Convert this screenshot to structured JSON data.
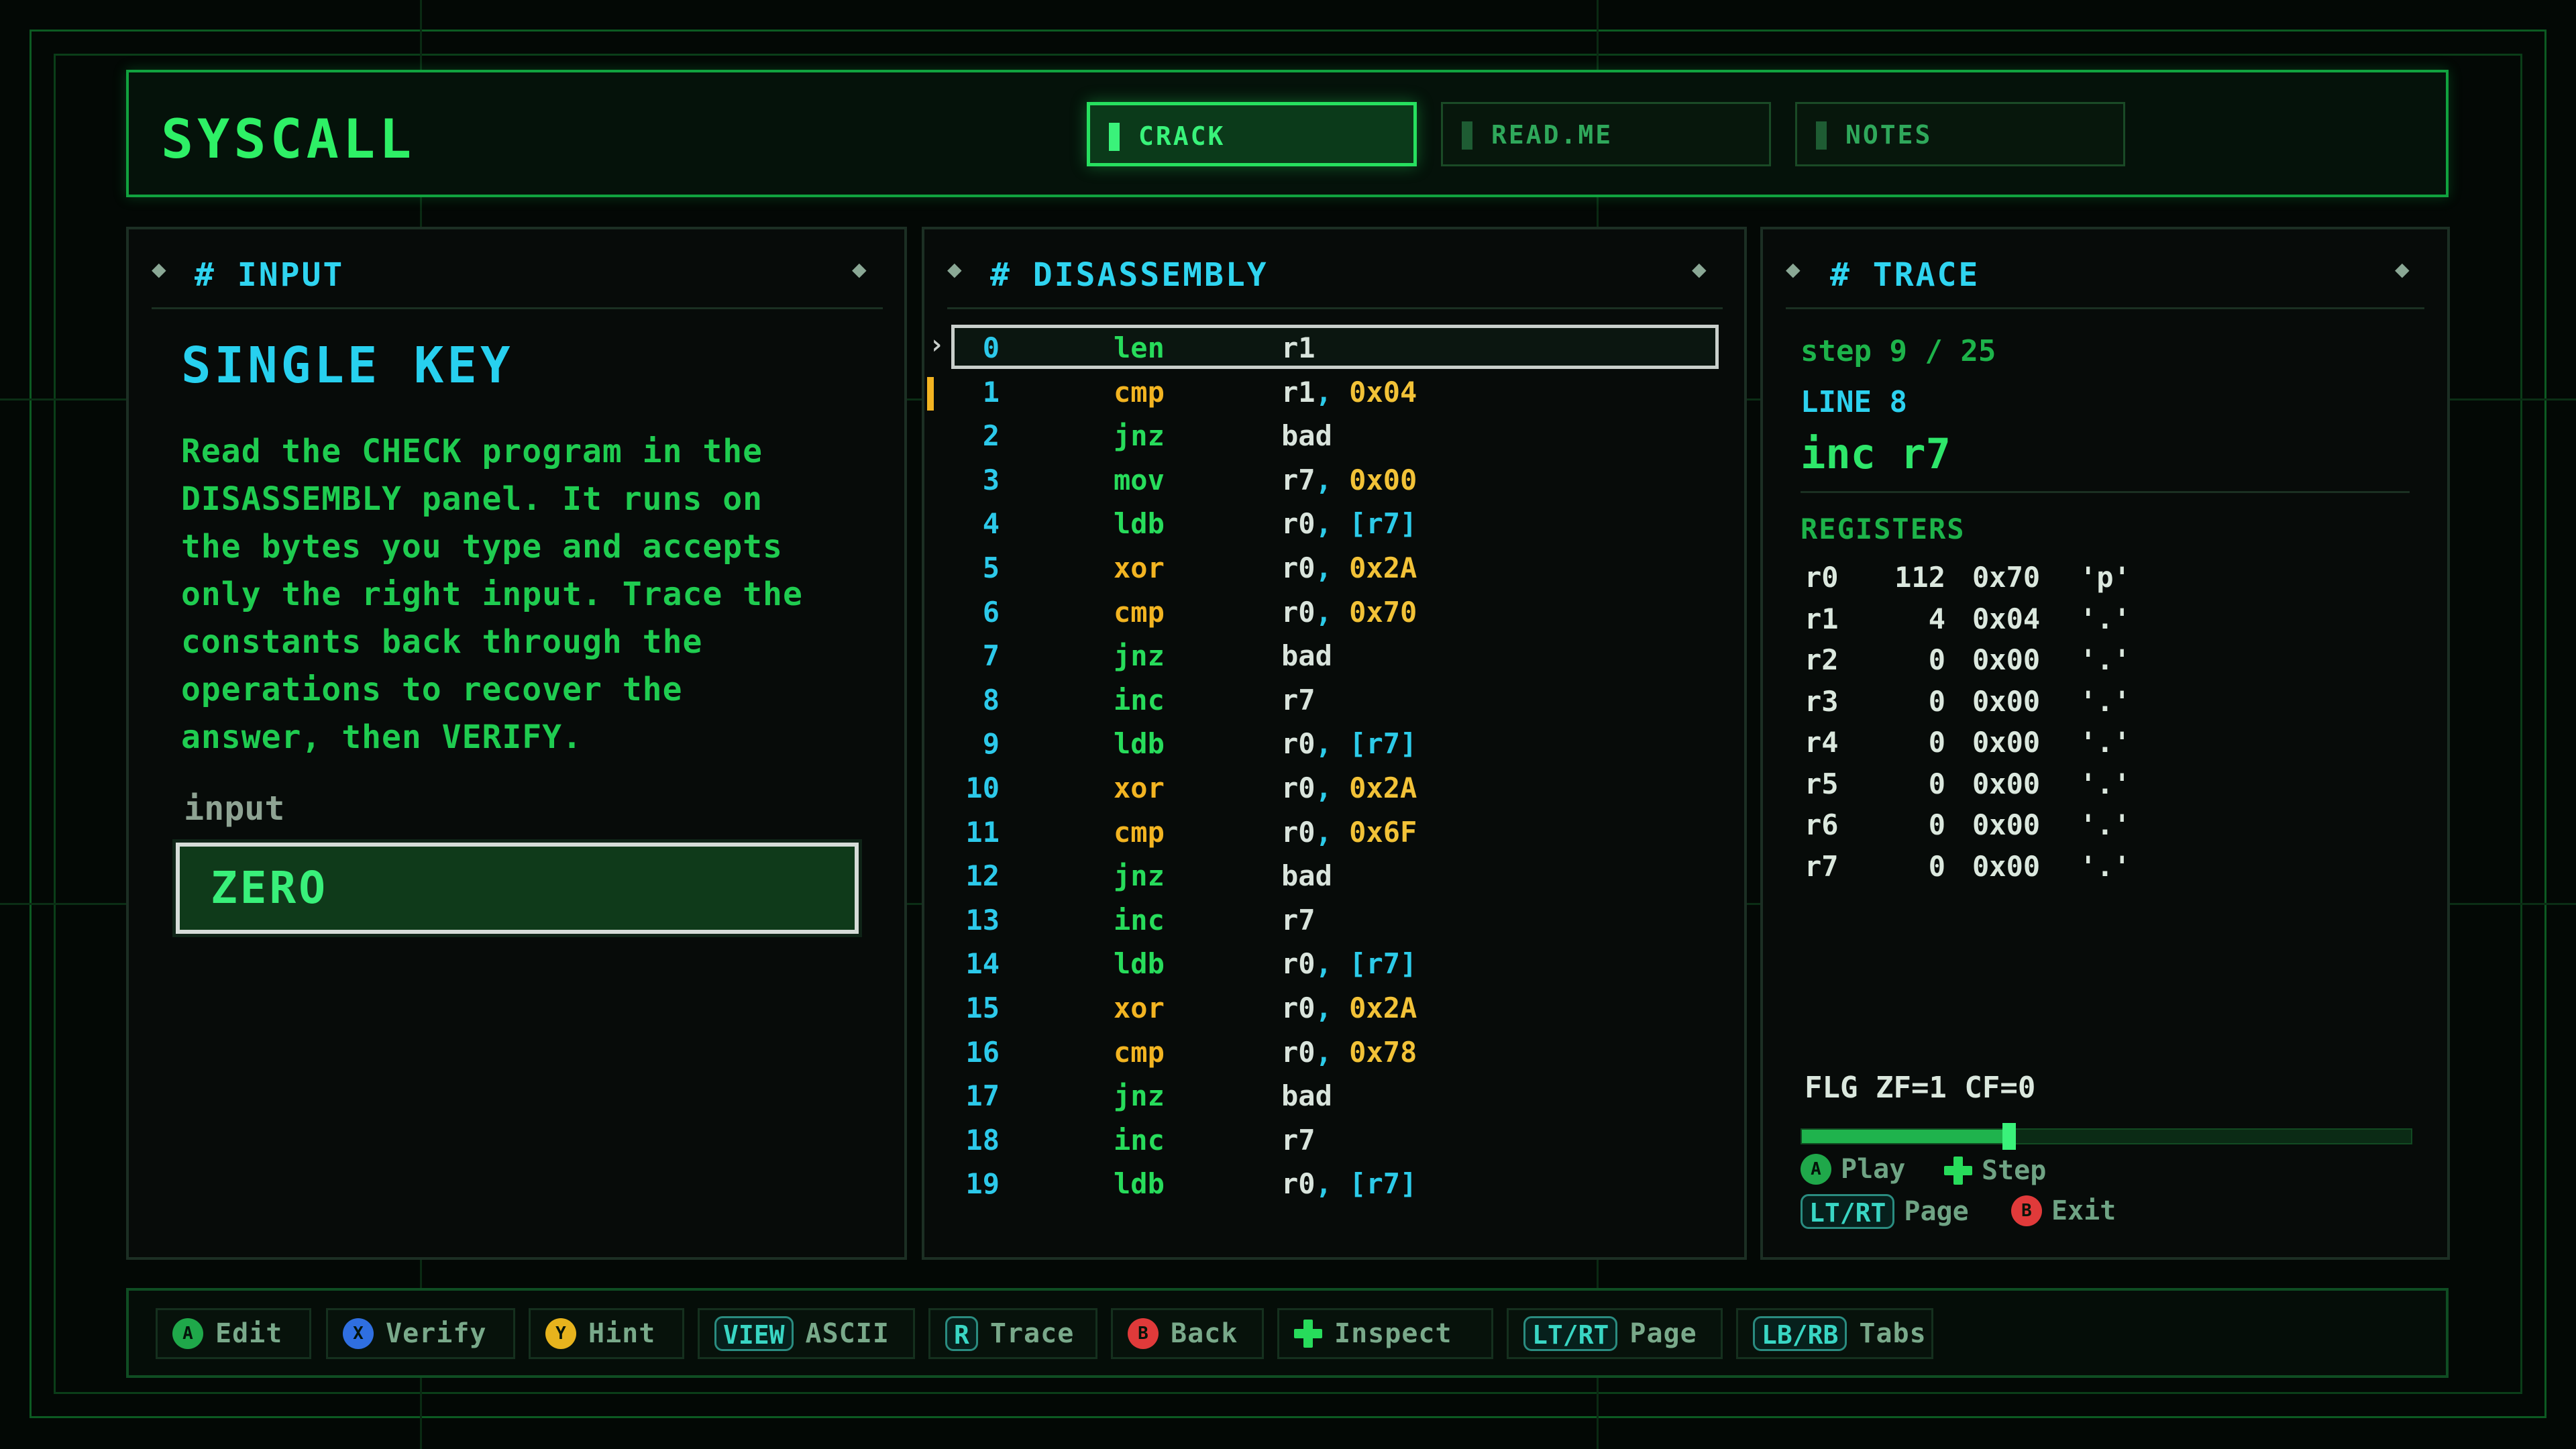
{
  "app": {
    "title": "SYSCALL"
  },
  "tabs": [
    {
      "label": "CRACK",
      "active": true
    },
    {
      "label": "READ.ME",
      "active": false
    },
    {
      "label": "NOTES",
      "active": false
    }
  ],
  "input_panel": {
    "header": "# INPUT",
    "title": "SINGLE KEY",
    "description": [
      "Read the CHECK program in the",
      "DISASSEMBLY panel. It runs on",
      "the bytes you type and accepts",
      "only the right input. Trace the",
      "constants back through the",
      "operations to recover the",
      "answer, then VERIFY."
    ],
    "field_label": "input",
    "field_value": "ZERO"
  },
  "disassembly_panel": {
    "header": "# DISASSEMBLY",
    "selected_index": 0,
    "breakpoint_index": 1,
    "lines": [
      {
        "idx": "0",
        "op": "len",
        "args": [
          {
            "t": "r1",
            "k": "reg"
          }
        ]
      },
      {
        "idx": "1",
        "op": "cmp",
        "args": [
          {
            "t": "r1",
            "k": "reg"
          },
          {
            "t": "0x04",
            "k": "imm"
          }
        ]
      },
      {
        "idx": "2",
        "op": "jnz",
        "args": [
          {
            "t": "bad",
            "k": "reg"
          }
        ]
      },
      {
        "idx": "3",
        "op": "mov",
        "args": [
          {
            "t": "r7",
            "k": "reg"
          },
          {
            "t": "0x00",
            "k": "imm"
          }
        ]
      },
      {
        "idx": "4",
        "op": "ldb",
        "args": [
          {
            "t": "r0",
            "k": "reg"
          },
          {
            "t": "[r7]",
            "k": "mem"
          }
        ]
      },
      {
        "idx": "5",
        "op": "xor",
        "args": [
          {
            "t": "r0",
            "k": "reg"
          },
          {
            "t": "0x2A",
            "k": "imm"
          }
        ]
      },
      {
        "idx": "6",
        "op": "cmp",
        "args": [
          {
            "t": "r0",
            "k": "reg"
          },
          {
            "t": "0x70",
            "k": "imm"
          }
        ]
      },
      {
        "idx": "7",
        "op": "jnz",
        "args": [
          {
            "t": "bad",
            "k": "reg"
          }
        ]
      },
      {
        "idx": "8",
        "op": "inc",
        "args": [
          {
            "t": "r7",
            "k": "reg"
          }
        ]
      },
      {
        "idx": "9",
        "op": "ldb",
        "args": [
          {
            "t": "r0",
            "k": "reg"
          },
          {
            "t": "[r7]",
            "k": "mem"
          }
        ]
      },
      {
        "idx": "10",
        "op": "xor",
        "args": [
          {
            "t": "r0",
            "k": "reg"
          },
          {
            "t": "0x2A",
            "k": "imm"
          }
        ]
      },
      {
        "idx": "11",
        "op": "cmp",
        "args": [
          {
            "t": "r0",
            "k": "reg"
          },
          {
            "t": "0x6F",
            "k": "imm"
          }
        ]
      },
      {
        "idx": "12",
        "op": "jnz",
        "args": [
          {
            "t": "bad",
            "k": "reg"
          }
        ]
      },
      {
        "idx": "13",
        "op": "inc",
        "args": [
          {
            "t": "r7",
            "k": "reg"
          }
        ]
      },
      {
        "idx": "14",
        "op": "ldb",
        "args": [
          {
            "t": "r0",
            "k": "reg"
          },
          {
            "t": "[r7]",
            "k": "mem"
          }
        ]
      },
      {
        "idx": "15",
        "op": "xor",
        "args": [
          {
            "t": "r0",
            "k": "reg"
          },
          {
            "t": "0x2A",
            "k": "imm"
          }
        ]
      },
      {
        "idx": "16",
        "op": "cmp",
        "args": [
          {
            "t": "r0",
            "k": "reg"
          },
          {
            "t": "0x78",
            "k": "imm"
          }
        ]
      },
      {
        "idx": "17",
        "op": "jnz",
        "args": [
          {
            "t": "bad",
            "k": "reg"
          }
        ]
      },
      {
        "idx": "18",
        "op": "inc",
        "args": [
          {
            "t": "r7",
            "k": "reg"
          }
        ]
      },
      {
        "idx": "19",
        "op": "ldb",
        "args": [
          {
            "t": "r0",
            "k": "reg"
          },
          {
            "t": "[r7]",
            "k": "mem"
          }
        ]
      }
    ]
  },
  "trace_panel": {
    "header": "# TRACE",
    "step": "step 9 / 25",
    "line": "LINE 8",
    "instruction": "inc r7",
    "registers_title": "REGISTERS",
    "registers": [
      {
        "name": "r0",
        "dec": "112",
        "hex": "0x70",
        "chr": "'p'"
      },
      {
        "name": "r1",
        "dec": "4",
        "hex": "0x04",
        "chr": "'.'"
      },
      {
        "name": "r2",
        "dec": "0",
        "hex": "0x00",
        "chr": "'.'"
      },
      {
        "name": "r3",
        "dec": "0",
        "hex": "0x00",
        "chr": "'.'"
      },
      {
        "name": "r4",
        "dec": "0",
        "hex": "0x00",
        "chr": "'.'"
      },
      {
        "name": "r5",
        "dec": "0",
        "hex": "0x00",
        "chr": "'.'"
      },
      {
        "name": "r6",
        "dec": "0",
        "hex": "0x00",
        "chr": "'.'"
      },
      {
        "name": "r7",
        "dec": "0",
        "hex": "0x00",
        "chr": "'.'"
      }
    ],
    "flags": "FLG ZF=1 CF=0",
    "progress_fraction": 0.34,
    "controls": {
      "play_btn": "A",
      "play_label": "Play",
      "step_label": "Step",
      "page_pill": "LT/RT",
      "page_label": "Page",
      "exit_btn": "B",
      "exit_label": "Exit"
    }
  },
  "footer": [
    {
      "key": "A",
      "kind": "circle",
      "color": "#1fa84a",
      "label": "Edit"
    },
    {
      "key": "X",
      "kind": "circle",
      "color": "#2f6fe0",
      "label": "Verify"
    },
    {
      "key": "Y",
      "kind": "circle",
      "color": "#e7b31d",
      "label": "Hint"
    },
    {
      "key": "VIEW",
      "kind": "pill",
      "color": "#2a8c80",
      "label": "ASCII"
    },
    {
      "key": "R",
      "kind": "pill",
      "color": "#2a8c80",
      "label": "Trace"
    },
    {
      "key": "B",
      "kind": "circle",
      "color": "#e03a3a",
      "label": "Back"
    },
    {
      "key": "",
      "kind": "plus",
      "color": "#27dc5b",
      "label": "Inspect"
    },
    {
      "key": "LT/RT",
      "kind": "pill",
      "color": "#2a8c80",
      "label": "Page"
    },
    {
      "key": "LB/RB",
      "kind": "pill",
      "color": "#2a8c80",
      "label": "Tabs"
    }
  ],
  "colors": {
    "accent": "#27e05f",
    "cyan": "#2cd1ef",
    "amber": "#f2b421"
  }
}
